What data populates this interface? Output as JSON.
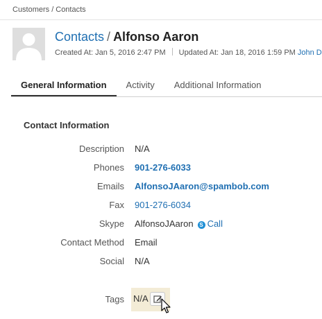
{
  "breadcrumb": {
    "items": [
      "Customers",
      "Contacts"
    ],
    "separator": "/"
  },
  "header": {
    "entity_link": "Contacts",
    "separator": "/",
    "record_name": "Alfonso Aaron",
    "created_label": "Created At:",
    "created_value": "Jan 5, 2016 2:47 PM",
    "updated_label": "Updated At:",
    "updated_value": "Jan 18, 2016 1:59 PM",
    "updated_by": "John D"
  },
  "tabs": [
    {
      "label": "General Information",
      "active": true
    },
    {
      "label": "Activity",
      "active": false
    },
    {
      "label": "Additional Information",
      "active": false
    }
  ],
  "section": {
    "title": "Contact Information"
  },
  "fields": {
    "description": {
      "label": "Description",
      "value": "N/A"
    },
    "phones": {
      "label": "Phones",
      "value": "901-276-6033"
    },
    "emails": {
      "label": "Emails",
      "value": "AlfonsoJAaron@spambob.com"
    },
    "fax": {
      "label": "Fax",
      "value": "901-276-6034"
    },
    "skype": {
      "label": "Skype",
      "value": "AlfonsoJAaron",
      "call_label": "Call",
      "icon": "skype-icon"
    },
    "contact_method": {
      "label": "Contact Method",
      "value": "Email"
    },
    "social": {
      "label": "Social",
      "value": "N/A"
    },
    "tags": {
      "label": "Tags",
      "value": "N/A",
      "edit_icon": "pencil-icon"
    }
  },
  "colors": {
    "link": "#1f6fb2",
    "tags_highlight": "#f3ecd6",
    "avatar_bg": "#dedede"
  }
}
